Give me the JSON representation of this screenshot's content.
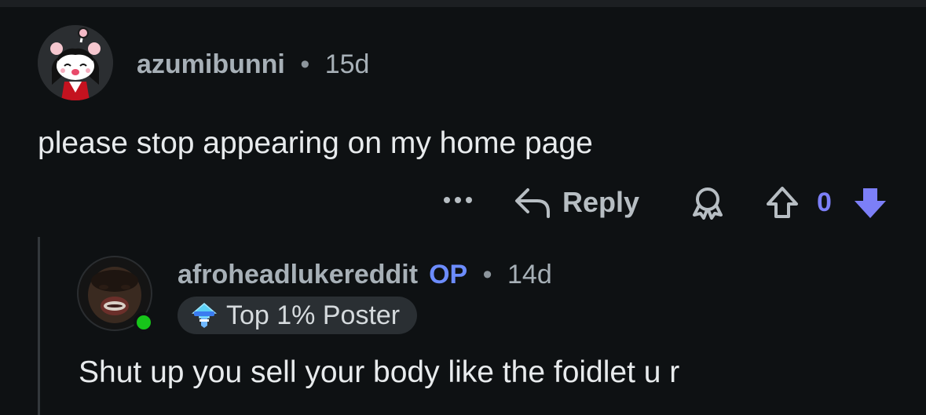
{
  "comment": {
    "username": "azumibunni",
    "separator": "•",
    "time": "15d",
    "body": "please stop appearing on my home page",
    "actions": {
      "more_icon": "more-dots-icon",
      "reply_label": "Reply",
      "award_icon": "award-icon",
      "upvote_icon": "upvote-icon",
      "vote_count": "0",
      "downvote_icon": "downvote-icon",
      "downvote_color": "#7c7ff7"
    }
  },
  "reply": {
    "username": "afroheadlukereddit",
    "op_label": "OP",
    "separator": "•",
    "time": "14d",
    "flair_label": "Top 1% Poster",
    "flair_icon": "top-poster-icon",
    "body": "Shut up you sell your body like the foidlet u r",
    "online_status_color": "#17c51a"
  }
}
